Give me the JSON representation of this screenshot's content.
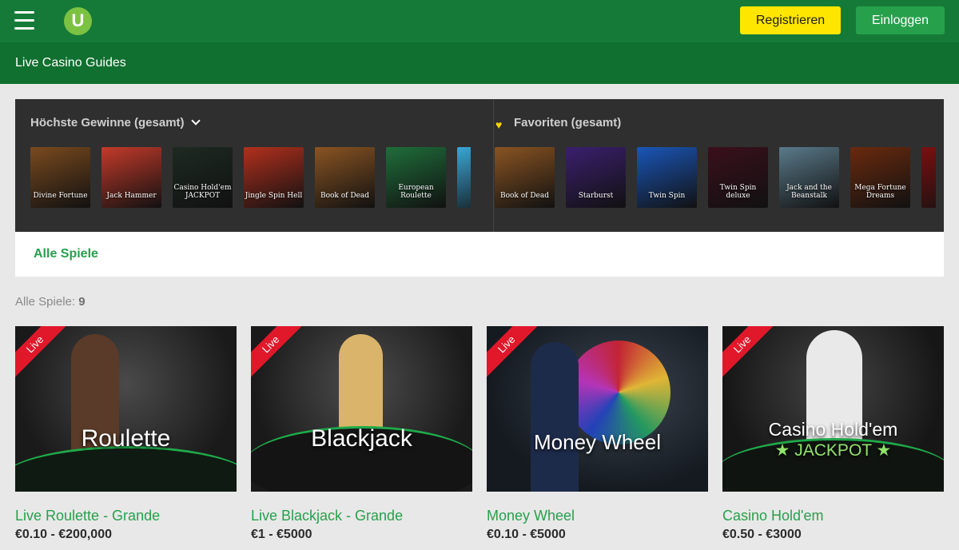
{
  "header": {
    "logo_text": "U",
    "register_label": "Registrieren",
    "login_label": "Einloggen"
  },
  "subheader": {
    "title": "Live Casino Guides"
  },
  "top_wins": {
    "title": "Höchste Gewinne (gesamt)",
    "games": [
      {
        "name": "Divine Fortune",
        "bg": "#7a4a1e"
      },
      {
        "name": "Jack Hammer",
        "bg": "#c43a2a"
      },
      {
        "name": "Casino Hold'em JACKPOT",
        "bg": "#1d2a22"
      },
      {
        "name": "Jingle Spin Hell",
        "bg": "#b2301d"
      },
      {
        "name": "Book of Dead",
        "bg": "#8a5422"
      },
      {
        "name": "European Roulette",
        "bg": "#1f6e3a"
      },
      {
        "name": "",
        "bg": "#3aa6d6"
      }
    ]
  },
  "favorites": {
    "title": "Favoriten (gesamt)",
    "games": [
      {
        "name": "Book of Dead",
        "bg": "#8a5422"
      },
      {
        "name": "Starburst",
        "bg": "#3b1f6e"
      },
      {
        "name": "Twin Spin",
        "bg": "#1a56b8"
      },
      {
        "name": "Twin Spin deluxe",
        "bg": "#3a0f1c"
      },
      {
        "name": "Jack and the Beanstalk",
        "bg": "#5a7a8a"
      },
      {
        "name": "Mega Fortune Dreams",
        "bg": "#6a2a0e"
      },
      {
        "name": "",
        "bg": "#7a1010"
      }
    ]
  },
  "tabs": {
    "all_games": "Alle Spiele"
  },
  "count": {
    "label": "Alle Spiele:",
    "value": "9"
  },
  "live_badge": "Live",
  "cards": [
    {
      "overlay": "Roulette",
      "overlay2": "",
      "title": "Live Roulette - Grande",
      "range": "€0.10 - €200,000",
      "bg": "#3a3a3a"
    },
    {
      "overlay": "Blackjack",
      "overlay2": "",
      "title": "Live Blackjack - Grande",
      "range": "€1 - €5000",
      "bg": "#2f2f2f"
    },
    {
      "overlay": "Money Wheel",
      "overlay2": "",
      "title": "Money Wheel",
      "range": "€0.10 - €5000",
      "bg": "#222f3a"
    },
    {
      "overlay": "Casino Hold'em",
      "overlay2": "★ JACKPOT ★",
      "title": "Casino Hold'em",
      "range": "€0.50 - €3000",
      "bg": "#2a2a2a"
    }
  ],
  "colors": {
    "brand_green": "#157a37",
    "accent_green": "#27a04c",
    "register_yellow": "#ffe600",
    "live_red": "#e0182a"
  }
}
